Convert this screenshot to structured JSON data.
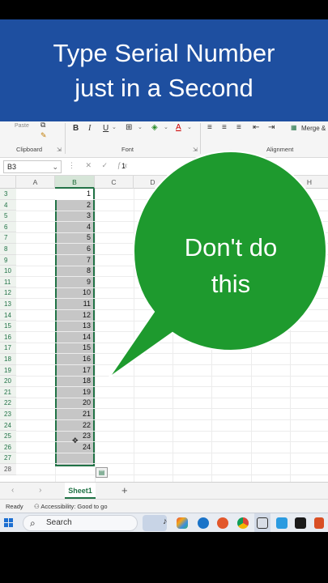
{
  "banner": {
    "line1": "Type Serial Number",
    "line2": "just in a Second"
  },
  "ribbon": {
    "paste_label": "Paste",
    "clipboard_label": "Clipboard",
    "font_label": "Font",
    "alignment_label": "Alignment",
    "merge_label": "Merge &",
    "bold": "B",
    "italic": "I",
    "underline": "U",
    "font_color_letter": "A"
  },
  "formula_bar": {
    "name_box": "B3",
    "value": "1"
  },
  "columns": [
    "A",
    "B",
    "C",
    "D",
    "H"
  ],
  "rows": [
    "3",
    "4",
    "5",
    "6",
    "7",
    "8",
    "9",
    "10",
    "11",
    "12",
    "13",
    "14",
    "15",
    "16",
    "17",
    "18",
    "19",
    "20",
    "21",
    "22",
    "23",
    "24",
    "25",
    "26",
    "27",
    "28"
  ],
  "b_values": [
    "1",
    "2",
    "3",
    "4",
    "5",
    "6",
    "7",
    "8",
    "9",
    "10",
    "11",
    "12",
    "13",
    "14",
    "15",
    "16",
    "17",
    "18",
    "19",
    "20",
    "21",
    "22",
    "23",
    "24"
  ],
  "bubble": {
    "line1": "Don't do",
    "line2": "this",
    "color": "#1e9a2e"
  },
  "sheet_tabs": {
    "active": "Sheet1",
    "add_label": "+"
  },
  "status": {
    "ready": "Ready",
    "accessibility": "Accessibility: Good to go"
  },
  "taskbar": {
    "search_label": "Search"
  },
  "colors": {
    "banner": "#1e4fa0",
    "excel_green": "#217346",
    "selection_fill": "#c6c6c6"
  }
}
